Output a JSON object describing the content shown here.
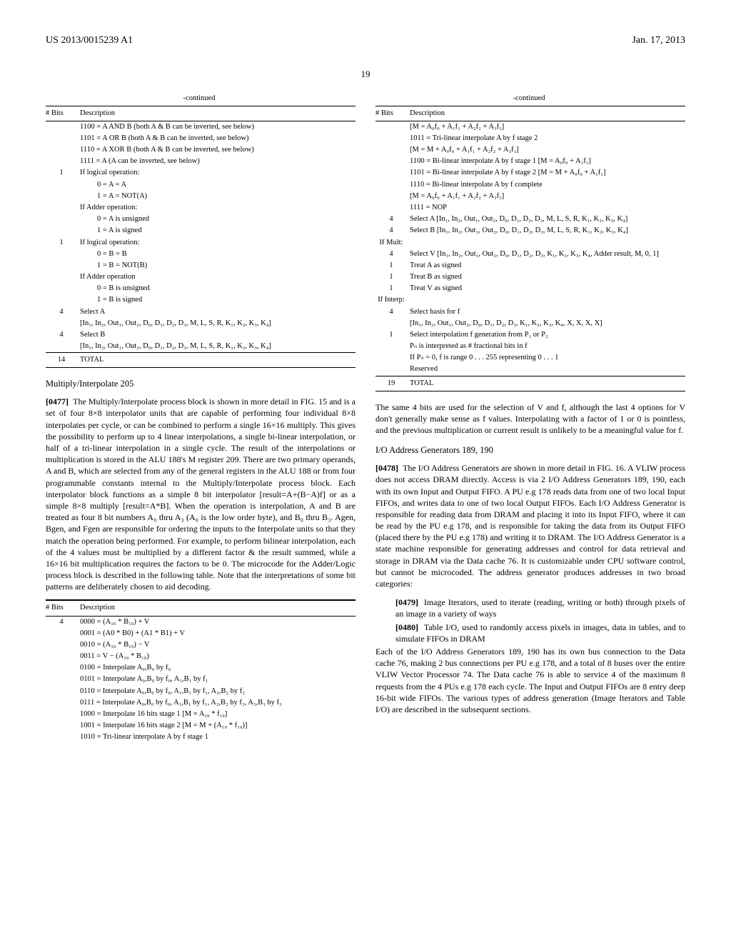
{
  "header": {
    "left": "US 2013/0015239 A1",
    "right": "Jan. 17, 2013"
  },
  "pagenum": "19",
  "col_left": {
    "table1": {
      "continued": "-continued",
      "h_bits": "# Bits",
      "h_desc": "Description",
      "rows": [
        {
          "b": "",
          "d": "1100 = A AND B (both A & B can be inverted, see below)"
        },
        {
          "b": "",
          "d": "1101 = A OR B (both A & B can be inverted, see below)"
        },
        {
          "b": "",
          "d": "1110 = A XOR B (both A & B can be inverted, see below)"
        },
        {
          "b": "",
          "d": "1111 = A (A can be inverted, see below)"
        },
        {
          "b": "1",
          "d": "If logical operation:"
        },
        {
          "b": "",
          "d": "0 = A = A",
          "indent": true
        },
        {
          "b": "",
          "d": "1 = A = NOT(A)",
          "indent": true
        },
        {
          "b": "",
          "d": "If Adder operation:"
        },
        {
          "b": "",
          "d": "0 = A is unsigned",
          "indent": true
        },
        {
          "b": "",
          "d": "1 = A is signed",
          "indent": true
        },
        {
          "b": "1",
          "d": "If logical operation:"
        },
        {
          "b": "",
          "d": "0 = B = B",
          "indent": true
        },
        {
          "b": "",
          "d": "1 = B = NOT(B)",
          "indent": true
        },
        {
          "b": "",
          "d": "If Adder operation"
        },
        {
          "b": "",
          "d": "0 = B is unsigned",
          "indent": true
        },
        {
          "b": "",
          "d": "1 = B is signed",
          "indent": true
        },
        {
          "b": "4",
          "d": "Select A"
        },
        {
          "b": "",
          "d": "[In₁, In₂, Out₁, Out₂, D₀, D₁, D₂, D₃, M, L, S, R, K₁, K₂, K₃, K₄]"
        },
        {
          "b": "4",
          "d": "Select B"
        },
        {
          "b": "",
          "d": "[In₁, In₂, Out₁, Out₂, D₀, D₁, D₂, D₃, M, L, S, R, K₁, K₂, K₃, K₄]"
        }
      ],
      "total_bits": "14",
      "total_label": "TOTAL"
    },
    "sect1_title": "Multiply/Interpolate 205",
    "para1_num": "[0477]",
    "para1": "The Multiply/Interpolate process block is shown in more detail in FIG. 15 and is a set of four 8×8 interpolator units that are capable of performing four individual 8×8 interpolates per cycle, or can be combined to perform a single 16×16 multiply. This gives the possibility to perform up to 4 linear interpolations, a single bi-linear interpolation, or half of a tri-linear interpolation in a single cycle. The result of the interpolations or multiplication is stored in the ALU 188's M register 209. There are two primary operands, A and B, which are selected from any of the general registers in the ALU 188 or from four programmable constants internal to the Multiply/Interpolate process block. Each interpolator block functions as a simple 8 bit interpolator [result=A+(B−A)f] or as a simple 8×8 multiply [result=A*B]. When the operation is interpolation, A and B are treated as four 8 bit numbers A₀ thru A₃ (A₀ is the low order byte), and B₀ thru B₃. Agen, Bgen, and Fgen are responsible for ordering the inputs to the Interpolate units so that they match the operation being performed. For example, to perform bilinear interpolation, each of the 4 values must be multiplied by a different factor & the result summed, while a 16×16 bit multiplication requires the factors to be 0. The microcode for the Adder/Logic process block is described in the following table. Note that the interpretations of some bit patterns are deliberately chosen to aid decoding.",
    "table2": {
      "h_bits": "# Bits",
      "h_desc": "Description",
      "rows": [
        {
          "b": "4",
          "d": "0000 = (A₁₀ * B₁₀) + V"
        },
        {
          "b": "",
          "d": "0001 = (A0 * B0) + (A1 * B1) + V"
        },
        {
          "b": "",
          "d": "0010 = (A₁₀ * B₁₀) − V"
        },
        {
          "b": "",
          "d": "0011 = V − (A₁₀ * B₁₀)"
        },
        {
          "b": "",
          "d": "0100 = Interpolate A₀,B₀ by f₀"
        },
        {
          "b": "",
          "d": "0101 = Interpolate A₀,B₀ by f₀, A₁,B₁ by f₁"
        },
        {
          "b": "",
          "d": "0110 = Interpolate A₀,B₀ by f₀, A₁,B₁ by f₁, A₂,B₂ by f₂"
        },
        {
          "b": "",
          "d": "0111 = Interpolate A₀,B₀ by f₀, A₁,B₁ by f₁, A₂,B₂ by f₂, A₃,B₃ by f₃"
        },
        {
          "b": "",
          "d": "1000 = Interpolate 16 bits stage 1 [M = A₁₀ * f₁₀]"
        },
        {
          "b": "",
          "d": "1001 = Interpolate 16 bits stage 2 [M = M + (A₁₀ * f₁₀)]"
        },
        {
          "b": "",
          "d": "1010 = Tri-linear interpolate A by f stage 1"
        }
      ]
    }
  },
  "col_right": {
    "table3": {
      "continued": "-continued",
      "h_bits": "# Bits",
      "h_desc": "Description",
      "rows": [
        {
          "b": "",
          "d": "[M = A₀f₀ + A₁f₁ + A₂f₂ + A₃f₃]"
        },
        {
          "b": "",
          "d": "1011 = Tri-linear interpolate A by f stage 2"
        },
        {
          "b": "",
          "d": "[M = M + A₀f₀ + A₁f₁ + A₂f₂ + A₃f₃]"
        },
        {
          "b": "",
          "d": "1100 = Bi-linear interpolate A by f stage 1 [M = A₀f₀ + A₁f₁]"
        },
        {
          "b": "",
          "d": "1101 = Bi-linear interpolate A by f stage 2 [M = M + A₀f₀ + A₁f₁]"
        },
        {
          "b": "",
          "d": "1110 = Bi-linear interpolate A by f complete"
        },
        {
          "b": "",
          "d": "[M = A₀f₀ + A₁f₁ + A₂f₂ + A₃f₃]"
        },
        {
          "b": "",
          "d": "1111 = NOP"
        },
        {
          "b": "4",
          "d": "Select A [In₁, In₂, Out₁, Out₂, D₀, D₁, D₂, D₃, M, L, S, R, K₁, K₂, K₃, K₄]"
        },
        {
          "b": "4",
          "d": "Select B [In₁, In₂, Out₁, Out₂, D₀, D₁, D₂, D₃, M, L, S, R, K₁, K₂, K₃, K₄]"
        },
        {
          "b": "If Mult:",
          "d": ""
        },
        {
          "b": "4",
          "d": "Select V [In₁, In₂, Out₁, Out₂, D₀, D₁, D₂, D₃, K₁, K₂, K₃, K₄, Adder result, M, 0, 1]"
        },
        {
          "b": "1",
          "d": "Treat A as signed"
        },
        {
          "b": "1",
          "d": "Treat B as signed"
        },
        {
          "b": "1",
          "d": "Treat V as signed"
        },
        {
          "b": "If Interp:",
          "d": ""
        },
        {
          "b": "4",
          "d": "Select basis for f"
        },
        {
          "b": "",
          "d": "[In₁, In₂, Out₁, Out₂, D₀, D₁, D₂, D₃, K₁, K₂, K₃, K₄, X, X, X, X]"
        },
        {
          "b": "1",
          "d": "Select interpolation f generation from P₁ or P₂"
        },
        {
          "b": "",
          "d": "Pₙ is interpreted as # fractional bits in f"
        },
        {
          "b": "",
          "d": "If Pₙ = 0, f is range 0 . . . 255 representing 0 . . . 1"
        },
        {
          "b": "",
          "d": "Reserved"
        }
      ],
      "total_bits": "19",
      "total_label": "TOTAL"
    },
    "para2": "The same 4 bits are used for the selection of V and f, although the last 4 options for V don't generally make sense as f values. Interpolating with a factor of 1 or 0 is pointless, and the previous multiplication or current result is unlikely to be a meaningful value for f.",
    "sect2_title": "I/O Address Generators 189, 190",
    "para3_num": "[0478]",
    "para3": "The I/O Address Generators are shown in more detail in FIG. 16. A VLIW process does not access DRAM directly. Access is via 2 I/O Address Generators 189, 190, each with its own Input and Output FIFO. A PU e.g 178 reads data from one of two local Input FIFOs, and writes data to one of two local Output FIFOs. Each I/O Address Generator is responsible for reading data from DRAM and placing it into its Input FIFO, where it can be read by the PU e.g 178, and is responsible for taking the data from its Output FIFO (placed there by the PU e.g 178) and writing it to DRAM. The I/O Address Generator is a state machine responsible for generating addresses and control for data retrieval and storage in DRAM via the Data cache 76. It is customizable under CPU software control, but cannot be microcoded. The address generator produces addresses in two broad categories:",
    "li1_num": "[0479]",
    "li1": "Image Iterators, used to iterate (reading, writing or both) through pixels of an image in a variety of ways",
    "li2_num": "[0480]",
    "li2": "Table I/O, used to randomly access pixels in images, data in tables, and to simulate FIFOs in DRAM",
    "para4": "Each of the I/O Address Generators 189, 190 has its own bus connection to the Data cache 76, making 2 bus connections per PU e.g 178, and a total of 8 buses over the entire VLIW Vector Processor 74. The Data cache 76 is able to service 4 of the maximum 8 requests from the 4 PUs e.g 178 each cycle. The Input and Output FIFOs are 8 entry deep 16-bit wide FIFOs. The various types of address generation (Image Iterators and Table I/O) are described in the subsequent sections."
  }
}
